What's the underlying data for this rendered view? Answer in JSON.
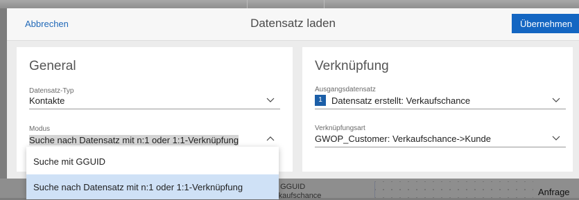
{
  "background": {
    "partial_text_1": "t GGUID",
    "partial_text_2": "rkaufschance",
    "anfrage_label": "Anfrage"
  },
  "dialog": {
    "cancel_label": "Abbrechen",
    "title": "Datensatz laden",
    "apply_label": "Übernehmen"
  },
  "general": {
    "heading": "General",
    "record_type": {
      "label": "Datensatz-Typ",
      "value": "Kontakte"
    },
    "mode": {
      "label": "Modus",
      "value": "Suche nach Datensatz mit n:1 oder 1:1-Verknüpfung",
      "options": [
        "Suche mit GGUID",
        "Suche nach Datensatz mit n:1 oder 1:1-Verknüpfung"
      ]
    }
  },
  "link": {
    "heading": "Verknüpfung",
    "source_record": {
      "label": "Ausgangsdatensatz",
      "badge": "1",
      "value": "Datensatz erstellt: Verkaufschance"
    },
    "link_type": {
      "label": "Verknüpfungsart",
      "value": "GWOP_Customer: Verkaufschance->Kunde"
    }
  },
  "colors": {
    "accent": "#1466c2",
    "link": "#2169b8",
    "selected_option": "#cfe1f6",
    "badge": "#1c5fa8"
  },
  "icons": {
    "dropdown_closed": "chevron-down-icon",
    "dropdown_open": "chevron-up-icon"
  }
}
